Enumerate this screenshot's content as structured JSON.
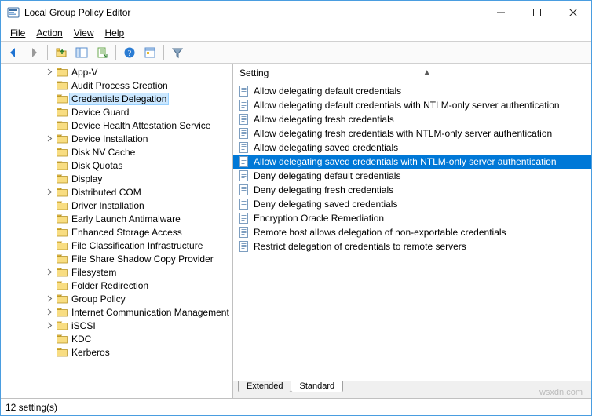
{
  "window": {
    "title": "Local Group Policy Editor"
  },
  "menubar": {
    "file": "File",
    "action": "Action",
    "view": "View",
    "help": "Help"
  },
  "toolbar_icons": {
    "back": "back-icon",
    "forward": "forward-icon",
    "up": "up-icon",
    "show_hide_tree": "show-hide-tree-icon",
    "export": "export-icon",
    "refresh": "refresh-icon",
    "help": "help-icon",
    "properties": "properties-icon",
    "filter": "filter-icon"
  },
  "tree": {
    "selected_index": 2,
    "items": [
      {
        "label": "App-V",
        "expandable": true
      },
      {
        "label": "Audit Process Creation",
        "expandable": false
      },
      {
        "label": "Credentials Delegation",
        "expandable": false
      },
      {
        "label": "Device Guard",
        "expandable": false
      },
      {
        "label": "Device Health Attestation Service",
        "expandable": false
      },
      {
        "label": "Device Installation",
        "expandable": true
      },
      {
        "label": "Disk NV Cache",
        "expandable": false
      },
      {
        "label": "Disk Quotas",
        "expandable": false
      },
      {
        "label": "Display",
        "expandable": false
      },
      {
        "label": "Distributed COM",
        "expandable": true
      },
      {
        "label": "Driver Installation",
        "expandable": false
      },
      {
        "label": "Early Launch Antimalware",
        "expandable": false
      },
      {
        "label": "Enhanced Storage Access",
        "expandable": false
      },
      {
        "label": "File Classification Infrastructure",
        "expandable": false
      },
      {
        "label": "File Share Shadow Copy Provider",
        "expandable": false
      },
      {
        "label": "Filesystem",
        "expandable": true
      },
      {
        "label": "Folder Redirection",
        "expandable": false
      },
      {
        "label": "Group Policy",
        "expandable": true
      },
      {
        "label": "Internet Communication Management",
        "expandable": true
      },
      {
        "label": "iSCSI",
        "expandable": true
      },
      {
        "label": "KDC",
        "expandable": false
      },
      {
        "label": "Kerberos",
        "expandable": false
      }
    ]
  },
  "list": {
    "column_header": "Setting",
    "sort_indicator": "▲",
    "selected_index": 5,
    "items": [
      "Allow delegating default credentials",
      "Allow delegating default credentials with NTLM-only server authentication",
      "Allow delegating fresh credentials",
      "Allow delegating fresh credentials with NTLM-only server authentication",
      "Allow delegating saved credentials",
      "Allow delegating saved credentials with NTLM-only server authentication",
      "Deny delegating default credentials",
      "Deny delegating fresh credentials",
      "Deny delegating saved credentials",
      "Encryption Oracle Remediation",
      "Remote host allows delegation of non-exportable credentials",
      "Restrict delegation of credentials to remote servers"
    ]
  },
  "tabs": {
    "extended": "Extended",
    "standard": "Standard"
  },
  "statusbar": {
    "text": "12 setting(s)"
  },
  "watermark": "wsxdn.com"
}
